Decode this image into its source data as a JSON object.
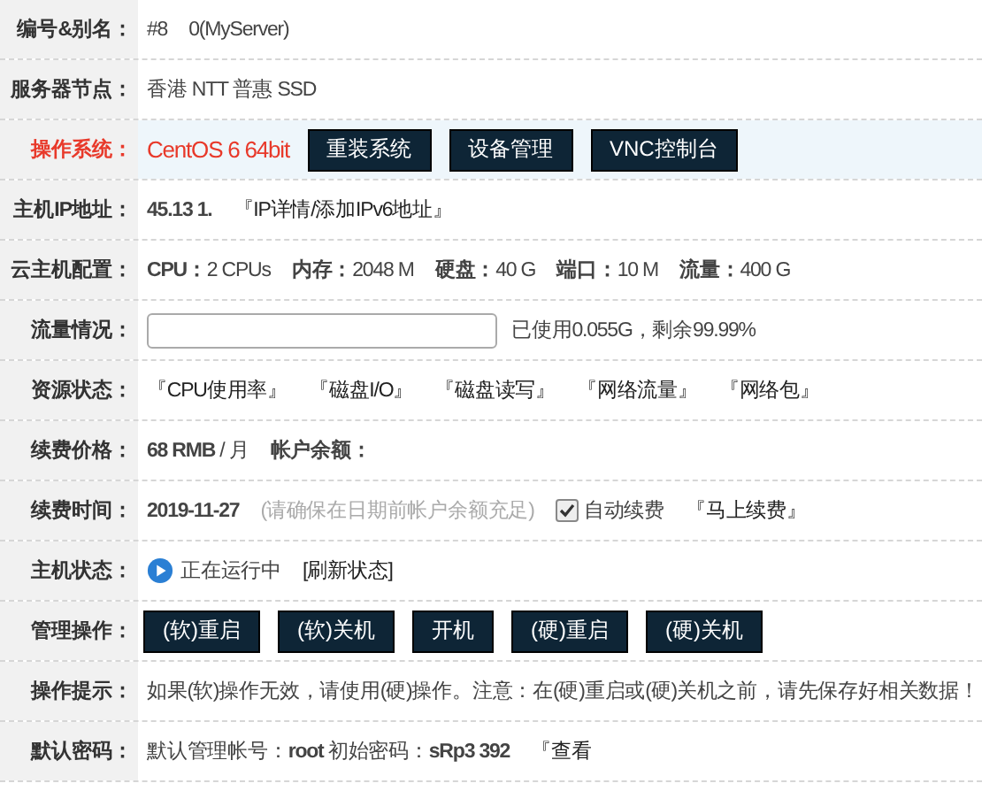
{
  "rows": [
    {
      "label": "编号&别名：",
      "alert": false,
      "items": [
        {
          "kind": "value",
          "text": "#8"
        },
        {
          "kind": "value",
          "text": "0(MyServer)"
        }
      ]
    },
    {
      "label": "服务器节点：",
      "alert": false,
      "items": [
        {
          "kind": "value",
          "text": "香港 NTT 普惠 SSD"
        }
      ]
    },
    {
      "label": "操作系统：",
      "alert": true,
      "items": [
        {
          "kind": "value",
          "text": "CentOS 6 64bit"
        },
        {
          "kind": "button",
          "text": "重装系统"
        },
        {
          "kind": "button",
          "text": "设备管理"
        },
        {
          "kind": "button",
          "text": "VNC控制台"
        }
      ]
    },
    {
      "label": "主机IP地址：",
      "alert": false,
      "items": [
        {
          "kind": "value",
          "text": "**45.13 1.**"
        },
        {
          "kind": "link",
          "text": "『IP详情/添加IPv6地址』"
        }
      ]
    },
    {
      "label": "云主机配置：",
      "alert": false,
      "items": [
        {
          "kind": "value",
          "text": "**CPU：**2 CPUs"
        },
        {
          "kind": "value",
          "text": "**内存：**2048 M"
        },
        {
          "kind": "value",
          "text": "**硬盘：**40 G"
        },
        {
          "kind": "value",
          "text": "**端口：**10 M"
        },
        {
          "kind": "value",
          "text": "**流量：**400 G"
        }
      ]
    },
    {
      "label": "流量情况：",
      "alert": false,
      "items": [
        {
          "kind": "meter",
          "level": 0.0001
        },
        {
          "kind": "value",
          "text": "已使用0.055G，剩余99.99%"
        }
      ]
    },
    {
      "label": "资源状态：",
      "alert": false,
      "items": [
        {
          "kind": "link",
          "text": "『CPU使用率』"
        },
        {
          "kind": "link",
          "text": "『磁盘I/O』"
        },
        {
          "kind": "link",
          "text": "『磁盘读写』"
        },
        {
          "kind": "link",
          "text": "『网络流量』"
        },
        {
          "kind": "link",
          "text": "『网络包』"
        }
      ]
    },
    {
      "label": "续费价格：",
      "alert": false,
      "items": [
        {
          "kind": "value",
          "text": "**68 RMB** / 月"
        },
        {
          "kind": "value",
          "text": "**帐户余额：**"
        }
      ]
    },
    {
      "label": "续费时间：",
      "alert": false,
      "items": [
        {
          "kind": "value",
          "text": "**2019-11-27**"
        },
        {
          "kind": "hint",
          "text": "(请确保在日期前帐户余额充足)"
        },
        {
          "kind": "checkbox",
          "text": "自动续费",
          "checked": true
        },
        {
          "kind": "link",
          "text": "『马上续费』"
        }
      ]
    },
    {
      "label": "主机状态：",
      "alert": false,
      "items": [
        {
          "kind": "status",
          "text": "正在运行中"
        },
        {
          "kind": "link",
          "text": "[刷新状态]"
        }
      ]
    },
    {
      "label": "管理操作：",
      "alert": false,
      "items": [
        {
          "kind": "button",
          "text": "(软)重启"
        },
        {
          "kind": "button",
          "text": "(软)关机"
        },
        {
          "kind": "button",
          "text": "开机"
        },
        {
          "kind": "button",
          "text": "(硬)重启"
        },
        {
          "kind": "button",
          "text": "(硬)关机"
        }
      ]
    },
    {
      "label": "操作提示：",
      "alert": false,
      "items": [
        {
          "kind": "value",
          "text": "如果(软)操作无效，请使用(硬)操作。注意：在(硬)重启或(硬)关机之前，请先保存好相关数据！"
        }
      ]
    },
    {
      "label": "默认密码：",
      "alert": false,
      "items": [
        {
          "kind": "value",
          "text": "默认管理帐号：**root**  初始密码：**sRp3 392**"
        },
        {
          "kind": "link",
          "text": "『查看"
        }
      ]
    }
  ]
}
